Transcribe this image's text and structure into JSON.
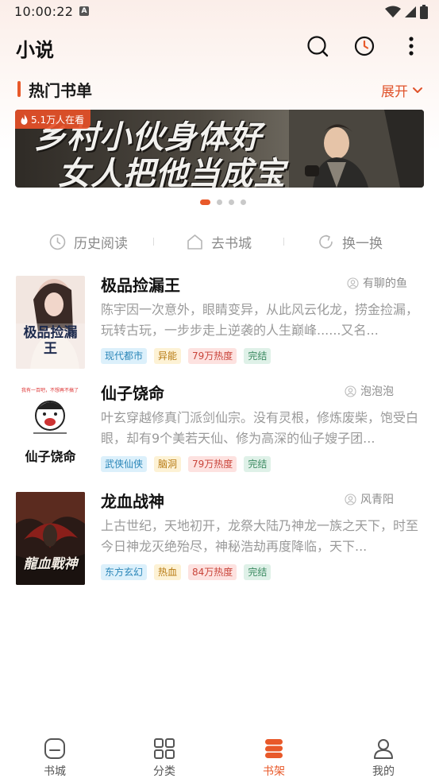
{
  "status_bar": {
    "time": "10:00:22",
    "notification_icon": "A"
  },
  "header": {
    "title": "小说",
    "search_icon": "search-icon",
    "history_icon": "clock-icon",
    "more_icon": "more-vertical-icon"
  },
  "section": {
    "title": "热门书单",
    "expand_label": "展开"
  },
  "banner": {
    "badge": "5.1万人在看",
    "line1": "乡村小伙身体好",
    "line2": "女人把他当成宝",
    "dots_total": 4,
    "active_dot": 0
  },
  "quick_actions": [
    {
      "label": "历史阅读",
      "icon": "clock-icon"
    },
    {
      "label": "去书城",
      "icon": "home-icon"
    },
    {
      "label": "换一换",
      "icon": "refresh-icon"
    }
  ],
  "books": [
    {
      "title": "极品捡漏王",
      "author": "有聊的鱼",
      "desc": "陈宇因一次意外，眼睛变异，从此风云化龙，捞金捡漏，玩转古玩，一步步走上逆袭的人生巅峰......又名...",
      "cover_text": "极品捡漏王",
      "tags": [
        "现代都市",
        "异能",
        "79万热度",
        "完结"
      ]
    },
    {
      "title": "仙子饶命",
      "author": "泡泡泡",
      "desc": "叶玄穿越修真门派剑仙宗。没有灵根，修炼废柴，饱受白眼，却有9个美若天仙、修为高深的仙子嫂子团...",
      "cover_text": "仙子饶命",
      "tags": [
        "武侠仙侠",
        "脑洞",
        "79万热度",
        "完结"
      ]
    },
    {
      "title": "龙血战神",
      "author": "风青阳",
      "desc": "上古世纪，天地初开，龙祭大陆乃神龙一族之天下，时至今日神龙灭绝殆尽，神秘浩劫再度降临，天下...",
      "cover_text": "龍血戰神",
      "tags": [
        "东方玄幻",
        "热血",
        "84万热度",
        "完结"
      ]
    }
  ],
  "bottom_nav": [
    {
      "label": "书城",
      "icon": "bookstore-icon",
      "active": false
    },
    {
      "label": "分类",
      "icon": "category-grid-icon",
      "active": false
    },
    {
      "label": "书架",
      "icon": "bookshelf-icon",
      "active": true
    },
    {
      "label": "我的",
      "icon": "profile-icon",
      "active": false
    }
  ],
  "colors": {
    "accent": "#e8592a",
    "text_primary": "#111111",
    "text_secondary": "#9a9a9a"
  }
}
